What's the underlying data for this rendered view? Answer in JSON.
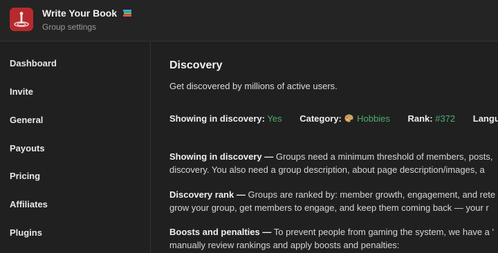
{
  "header": {
    "app_title": "Write Your Book",
    "app_subtitle": "Group settings",
    "title_icon": "books-icon",
    "logo_icon": "app-logo-icon",
    "brand_color": "#b62a2e"
  },
  "sidebar": {
    "items": [
      {
        "label": "Dashboard"
      },
      {
        "label": "Invite"
      },
      {
        "label": "General"
      },
      {
        "label": "Payouts"
      },
      {
        "label": "Pricing"
      },
      {
        "label": "Affiliates"
      },
      {
        "label": "Plugins"
      }
    ]
  },
  "main": {
    "title": "Discovery",
    "description": "Get discovered by millions of active users.",
    "stats": {
      "showing_label": "Showing in discovery:",
      "showing_value": "Yes",
      "category_label": "Category:",
      "category_icon": "palette-icon",
      "category_value": "Hobbies",
      "rank_label": "Rank:",
      "rank_value": "#372",
      "language_label": "Langu",
      "accent_color": "#4cae6e"
    },
    "paragraphs": [
      {
        "heading": "Showing in discovery —",
        "line1": " Groups need a minimum threshold of members, posts,",
        "line2": "discovery. You also need a group description, about page description/images, a"
      },
      {
        "heading": "Discovery rank —",
        "line1": " Groups are ranked by: member growth, engagement, and rete",
        "line2": "grow your group, get members to engage, and keep them coming back — your r"
      },
      {
        "heading": "Boosts and penalties —",
        "line1": " To prevent people from gaming the system, we have a '",
        "line2": "manually review rankings and apply boosts and penalties:"
      }
    ]
  }
}
